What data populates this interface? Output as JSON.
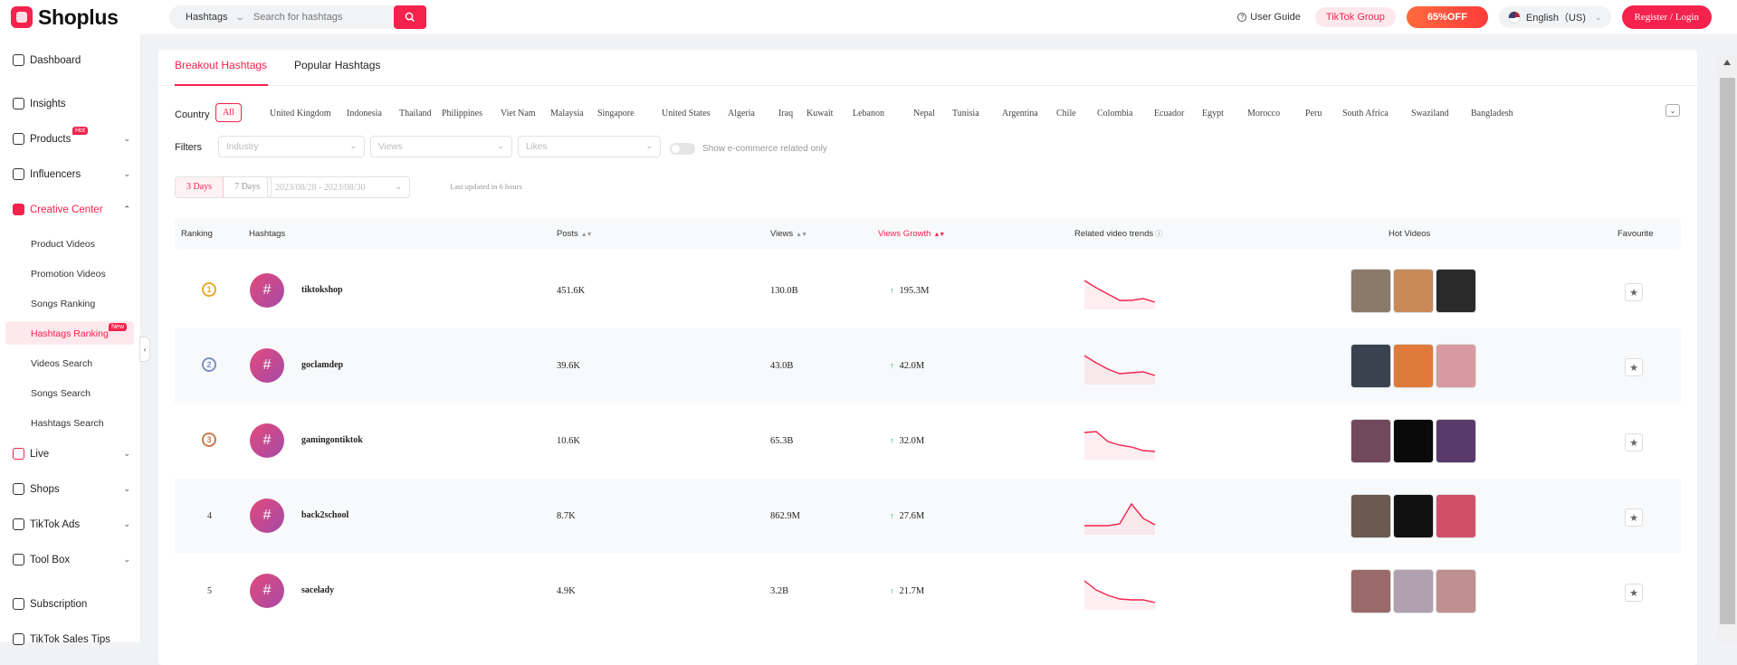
{
  "brand": {
    "name": "Shoplus"
  },
  "search": {
    "category": "Hashtags",
    "placeholder": "Search for hashtags"
  },
  "topbar": {
    "user_guide": "User Guide",
    "tiktok_group": "TikTok Group",
    "promo": "65%OFF",
    "language": "English（US)",
    "register": "Register / Login"
  },
  "sidebar": {
    "items": [
      {
        "label": "Dashboard"
      },
      {
        "label": "Insights"
      },
      {
        "label": "Products",
        "badge": "Hot"
      },
      {
        "label": "Influencers"
      },
      {
        "label": "Creative Center"
      },
      {
        "label": "Live"
      },
      {
        "label": "Shops"
      },
      {
        "label": "TikTok Ads"
      },
      {
        "label": "Tool Box"
      },
      {
        "label": "Subscription"
      },
      {
        "label": "TikTok Sales Tips"
      }
    ],
    "sub_items": [
      {
        "label": "Product Videos"
      },
      {
        "label": "Promotion Videos"
      },
      {
        "label": "Songs Ranking"
      },
      {
        "label": "Hashtags Ranking",
        "badge": "New"
      },
      {
        "label": "Videos Search"
      },
      {
        "label": "Songs Search"
      },
      {
        "label": "Hashtags Search"
      }
    ]
  },
  "tabs": [
    "Breakout Hashtags",
    "Popular Hashtags"
  ],
  "filters": {
    "country_label": "Country",
    "countries": [
      "All",
      "United Kingdom",
      "Indonesia",
      "Thailand",
      "Philippines",
      "Viet Nam",
      "Malaysia",
      "Singapore",
      "United States",
      "Algeria",
      "Iraq",
      "Kuwait",
      "Lebanon",
      "Nepal",
      "Tunisia",
      "Argentina",
      "Chile",
      "Colombia",
      "Ecuador",
      "Egypt",
      "Morocco",
      "Peru",
      "South Africa",
      "Swaziland",
      "Bangladesh"
    ],
    "filters_label": "Filters",
    "industry": "Industry",
    "views": "Views",
    "likes": "Likes",
    "ecommerce_toggle": "Show e-commerce related only",
    "days": [
      "3 Days",
      "7 Days"
    ],
    "date_range": "2023/08/28 - 2023/08/30",
    "updated": "Last updated in 6 hours"
  },
  "table": {
    "headers": {
      "ranking": "Ranking",
      "hashtags": "Hashtags",
      "posts": "Posts",
      "views": "Views",
      "views_growth": "Views Growth",
      "trends": "Related video trends",
      "hot_videos": "Hot Videos",
      "favourite": "Favourite"
    },
    "rows": [
      {
        "rank": "1",
        "tag": "tiktokshop",
        "posts": "451.6K",
        "views": "130.0B",
        "growth": "195.3M",
        "trend": [
          30,
          22,
          15,
          8,
          8,
          10,
          6
        ]
      },
      {
        "rank": "2",
        "tag": "goclamdep",
        "posts": "39.6K",
        "views": "43.0B",
        "growth": "42.0M",
        "trend": [
          30,
          22,
          15,
          10,
          11,
          12,
          8
        ]
      },
      {
        "rank": "3",
        "tag": "gamingontiktok",
        "posts": "10.6K",
        "views": "65.3B",
        "growth": "32.0M",
        "trend": [
          28,
          29,
          18,
          14,
          12,
          8,
          7
        ]
      },
      {
        "rank": "4",
        "tag": "back2school",
        "posts": "8.7K",
        "views": "862.9M",
        "growth": "27.6M",
        "trend": [
          8,
          8,
          8,
          10,
          32,
          16,
          9
        ]
      },
      {
        "rank": "5",
        "tag": "sacelady",
        "posts": "4.9K",
        "views": "3.2B",
        "growth": "21.7M",
        "trend": [
          30,
          20,
          14,
          10,
          9,
          9,
          6
        ]
      }
    ]
  },
  "colors": {
    "accent": "#f5224d",
    "gold": "#e8a82a",
    "silver": "#7d8fc4",
    "bronze": "#c9794f"
  }
}
